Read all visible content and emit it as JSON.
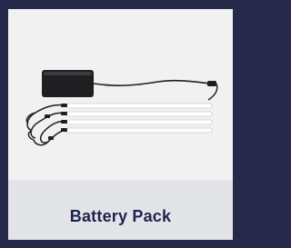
{
  "product_card": {
    "title": "Battery Pack",
    "image": {
      "subject": "battery-pack-with-led-light-bars",
      "background_color": "#f1f1f2"
    }
  },
  "colors": {
    "page_background": "#26294a",
    "card_background": "#e2e4e8",
    "title_color": "#1e2350"
  }
}
